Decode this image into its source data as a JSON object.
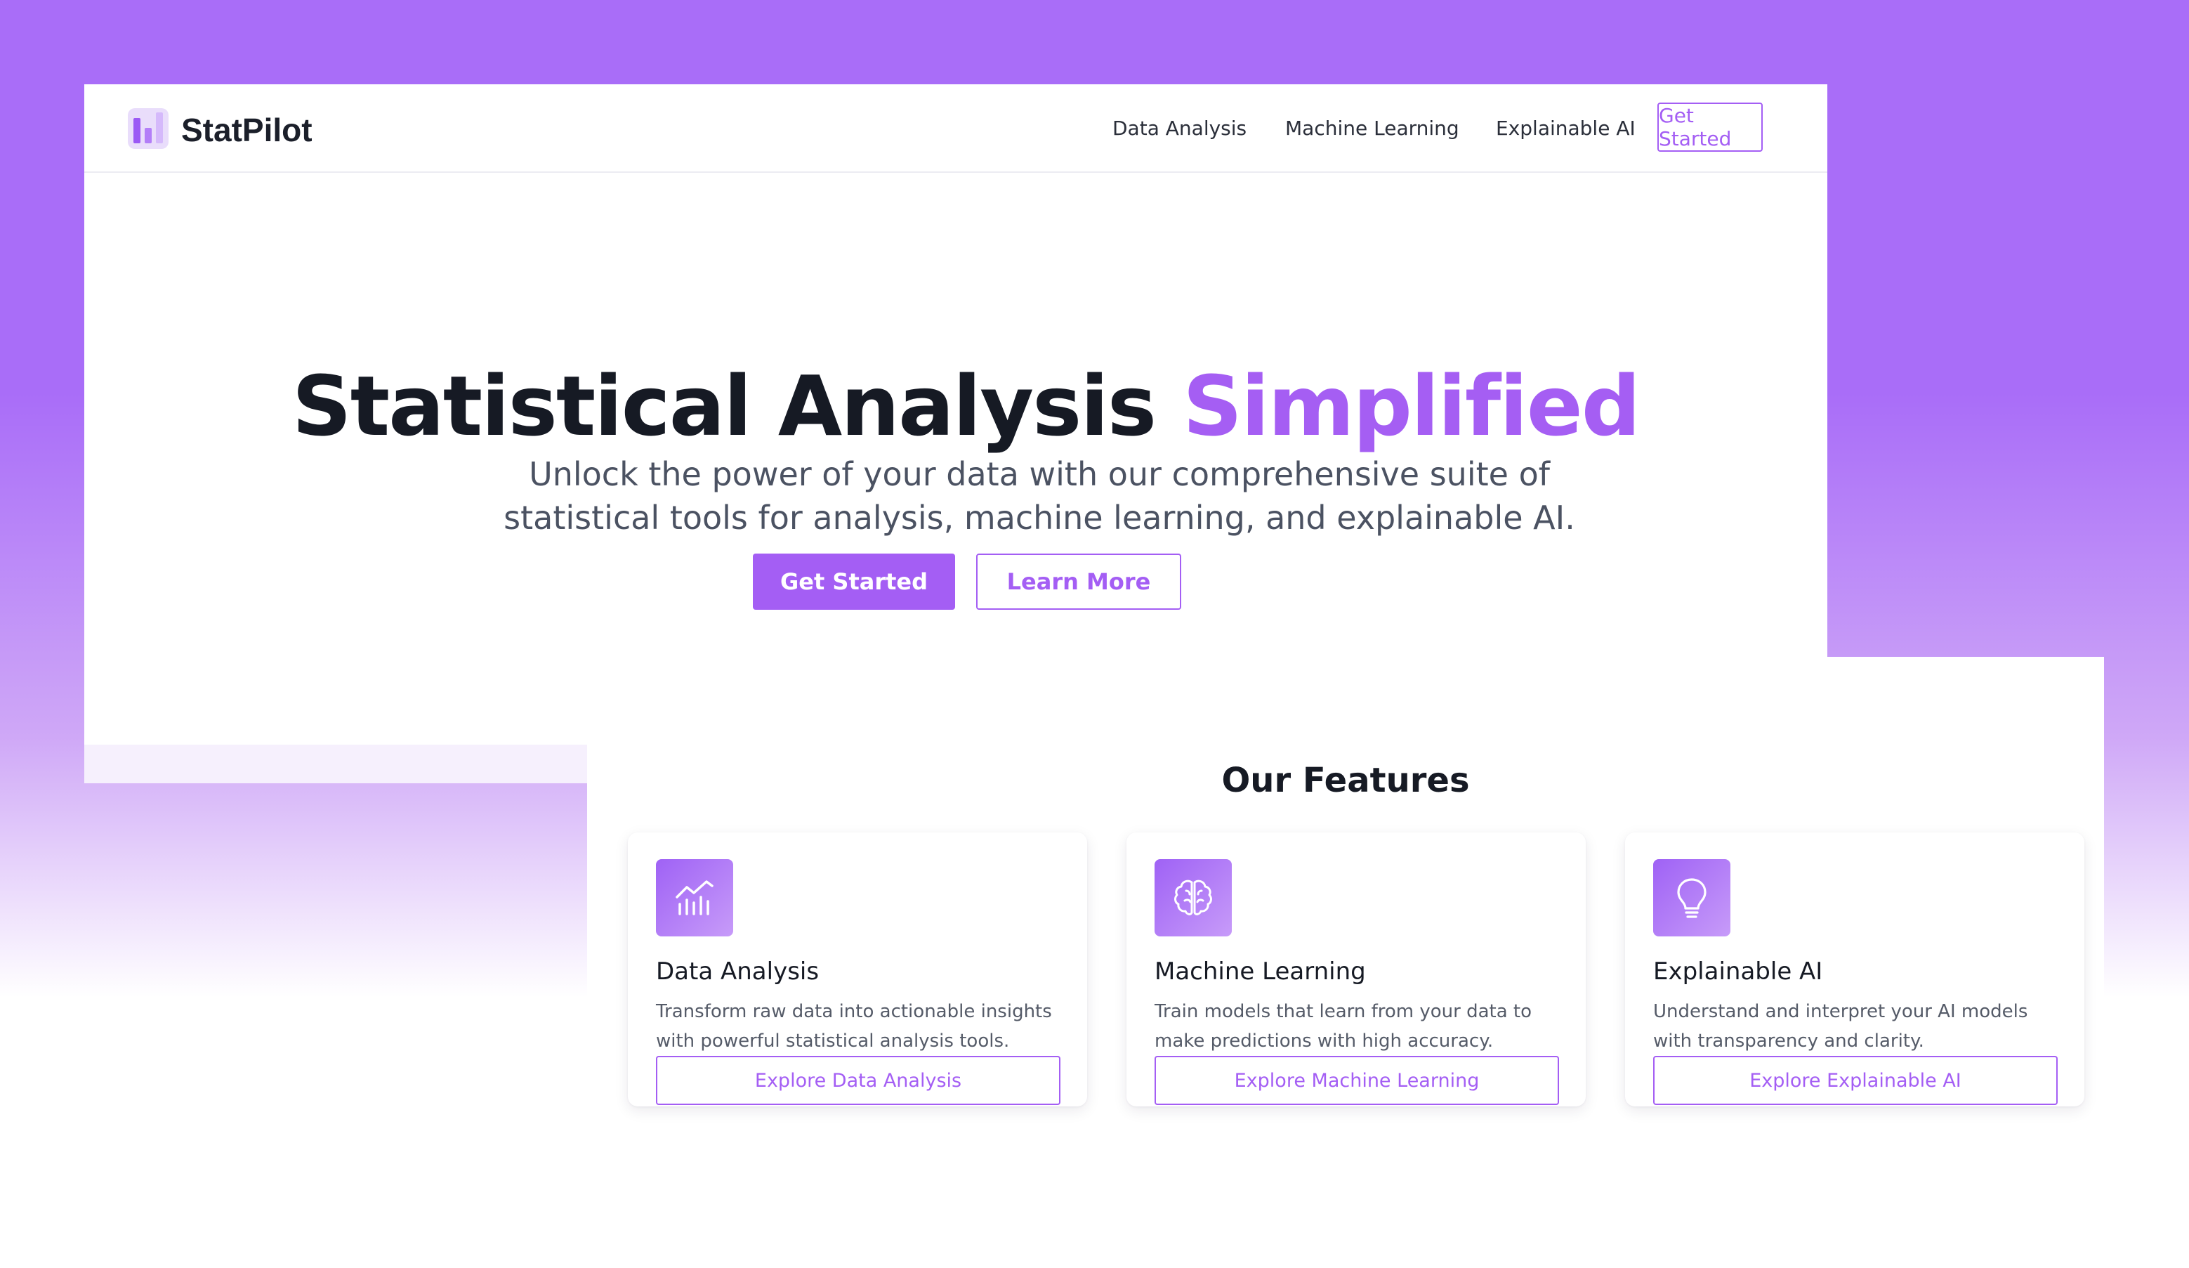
{
  "brand": {
    "name": "StatPilot",
    "logo_icon": "bar-chart-logo"
  },
  "nav": {
    "links": [
      "Data Analysis",
      "Machine Learning",
      "Explainable AI"
    ],
    "cta_label": "Get Started"
  },
  "hero": {
    "title_main": "Statistical Analysis ",
    "title_accent": "Simplified",
    "subtitle": "Unlock the power of your data with our comprehensive suite of statistical tools for analysis, machine learning, and explainable AI.",
    "primary_button": "Get Started",
    "secondary_button": "Learn More"
  },
  "features": {
    "heading": "Our Features",
    "cards": [
      {
        "icon": "chart-icon",
        "title": "Data Analysis",
        "description": "Transform raw data into actionable insights with powerful statistical analysis tools.",
        "button": "Explore Data Analysis"
      },
      {
        "icon": "brain-icon",
        "title": "Machine Learning",
        "description": "Train models that learn from your data to make predictions with high accuracy.",
        "button": "Explore Machine Learning"
      },
      {
        "icon": "lightbulb-icon",
        "title": "Explainable AI",
        "description": "Understand and interpret your AI models with transparency and clarity.",
        "button": "Explore Explainable AI"
      }
    ]
  },
  "colors": {
    "accent": "#a45ef4",
    "background": "#a96df8",
    "text_dark": "#161a24"
  }
}
